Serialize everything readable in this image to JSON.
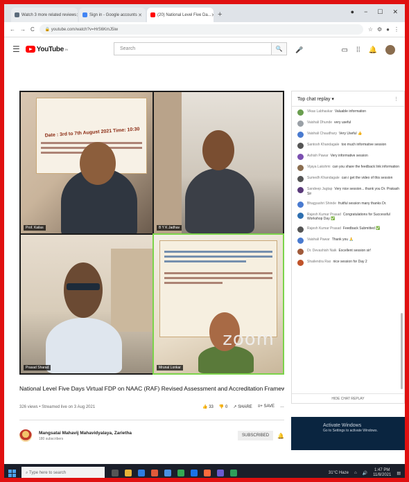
{
  "browser": {
    "tabs": [
      {
        "label": "Watch 3 more related reviews",
        "color": "#5b6b7b"
      },
      {
        "label": "Sign in - Google accounts",
        "color": "#4285f4"
      },
      {
        "label": "(20) National Level Five Da...",
        "color": "#ff0000",
        "active": true
      }
    ],
    "new_tab": "+",
    "window_controls": [
      "●",
      "−",
      "☐",
      "✕"
    ],
    "nav": [
      "←",
      "→",
      "C"
    ],
    "url": "youtube.com/watch?v=HrS6KmJ5iw"
  },
  "youtube": {
    "logo_text": "YouTube",
    "logo_sup": "IN",
    "search_placeholder": "Search",
    "header_icons": [
      "video-camera",
      "apps-grid",
      "notifications-bell",
      "account-avatar"
    ]
  },
  "video": {
    "tiles": [
      {
        "name": "Prof. Kailas",
        "banner": "Date : 3rd to 7th August 2021   Time: 10:30"
      },
      {
        "name": "B Y K Jadhav"
      },
      {
        "name": "Prasad Sharad"
      },
      {
        "name": "Mrunal Lonkar",
        "watermark": "zoom"
      }
    ]
  },
  "chat": {
    "header": "Top chat replay ▾",
    "messages": [
      {
        "author": "Vikas Labhaskar",
        "text": "Valuable information",
        "color": "#6a9e4f"
      },
      {
        "author": "Vaishali Dhunde",
        "text": "very useful",
        "color": "#9aa0a6"
      },
      {
        "author": "Vaishali Chaudhary",
        "text": "Very Useful 👍",
        "color": "#4a7bd0"
      },
      {
        "author": "Santosh Khandagale",
        "text": "too much informative session",
        "color": "#555"
      },
      {
        "author": "Ashish Pawar",
        "text": "Very informative session",
        "color": "#7b4fb0"
      },
      {
        "author": "Vijaya Lakshmi",
        "text": "can you share the feedback link information",
        "color": "#8a6d4f"
      },
      {
        "author": "Sumedh Khandagale",
        "text": "can i get the video of this session",
        "color": "#555"
      },
      {
        "author": "Sandeep Jagtap",
        "text": "Very nice session... thank you Dr. Prakash Sir",
        "color": "#5a3a7a"
      },
      {
        "author": "Bhagyashri Shinde",
        "text": "fruitful session many thanks Dr.",
        "color": "#4a7bd0"
      },
      {
        "author": "Rajesh Kumar Prasad",
        "text": "Congratulations for Successful Workshop Day ✅",
        "color": "#2e6fb0"
      },
      {
        "author": "Rajesh Kumar Prasad",
        "text": "Feedback Submitted ✅",
        "color": "#555"
      },
      {
        "author": "Vaishali Pawar",
        "text": "Thank you 🙏",
        "color": "#4a7bd0"
      },
      {
        "author": "Dr. Devashish Naik",
        "text": "Excellent session sir!",
        "color": "#a05a3a"
      },
      {
        "author": "Shailendra Rao",
        "text": "nice session for Day 2",
        "color": "#c0532a"
      }
    ],
    "footer": "HIDE CHAT REPLAY"
  },
  "details": {
    "title": "National Level Five Days Virtual FDP on NAAC (RAF) Revised Assessment and Accreditation Framework",
    "meta": "326 views • Streamed live on 3 Aug 2021",
    "likes": "33",
    "dislikes": "0",
    "share_label": "SHARE",
    "save_label": "SAVE",
    "more_label": "…",
    "channel_name": "Mangsatai Mahavij Mahavidyalaya, Zarietha",
    "subscribers": "180 subscribers",
    "subscribe_label": "SUBSCRIBED"
  },
  "watermark": {
    "line1": "Activate Windows",
    "line2": "Go to Settings to activate Windows."
  },
  "taskbar": {
    "search_placeholder": "Type here to search",
    "app_colors": [
      "#555",
      "#e8b339",
      "#2f7de1",
      "#e05a3a",
      "#4a90e2",
      "#34a853",
      "#1a73e8",
      "#ff6b3d",
      "#6b5bd0",
      "#2e9e5a"
    ],
    "weather": "31°C Haze",
    "time": "1:47 PM",
    "date": "11/8/2021"
  }
}
